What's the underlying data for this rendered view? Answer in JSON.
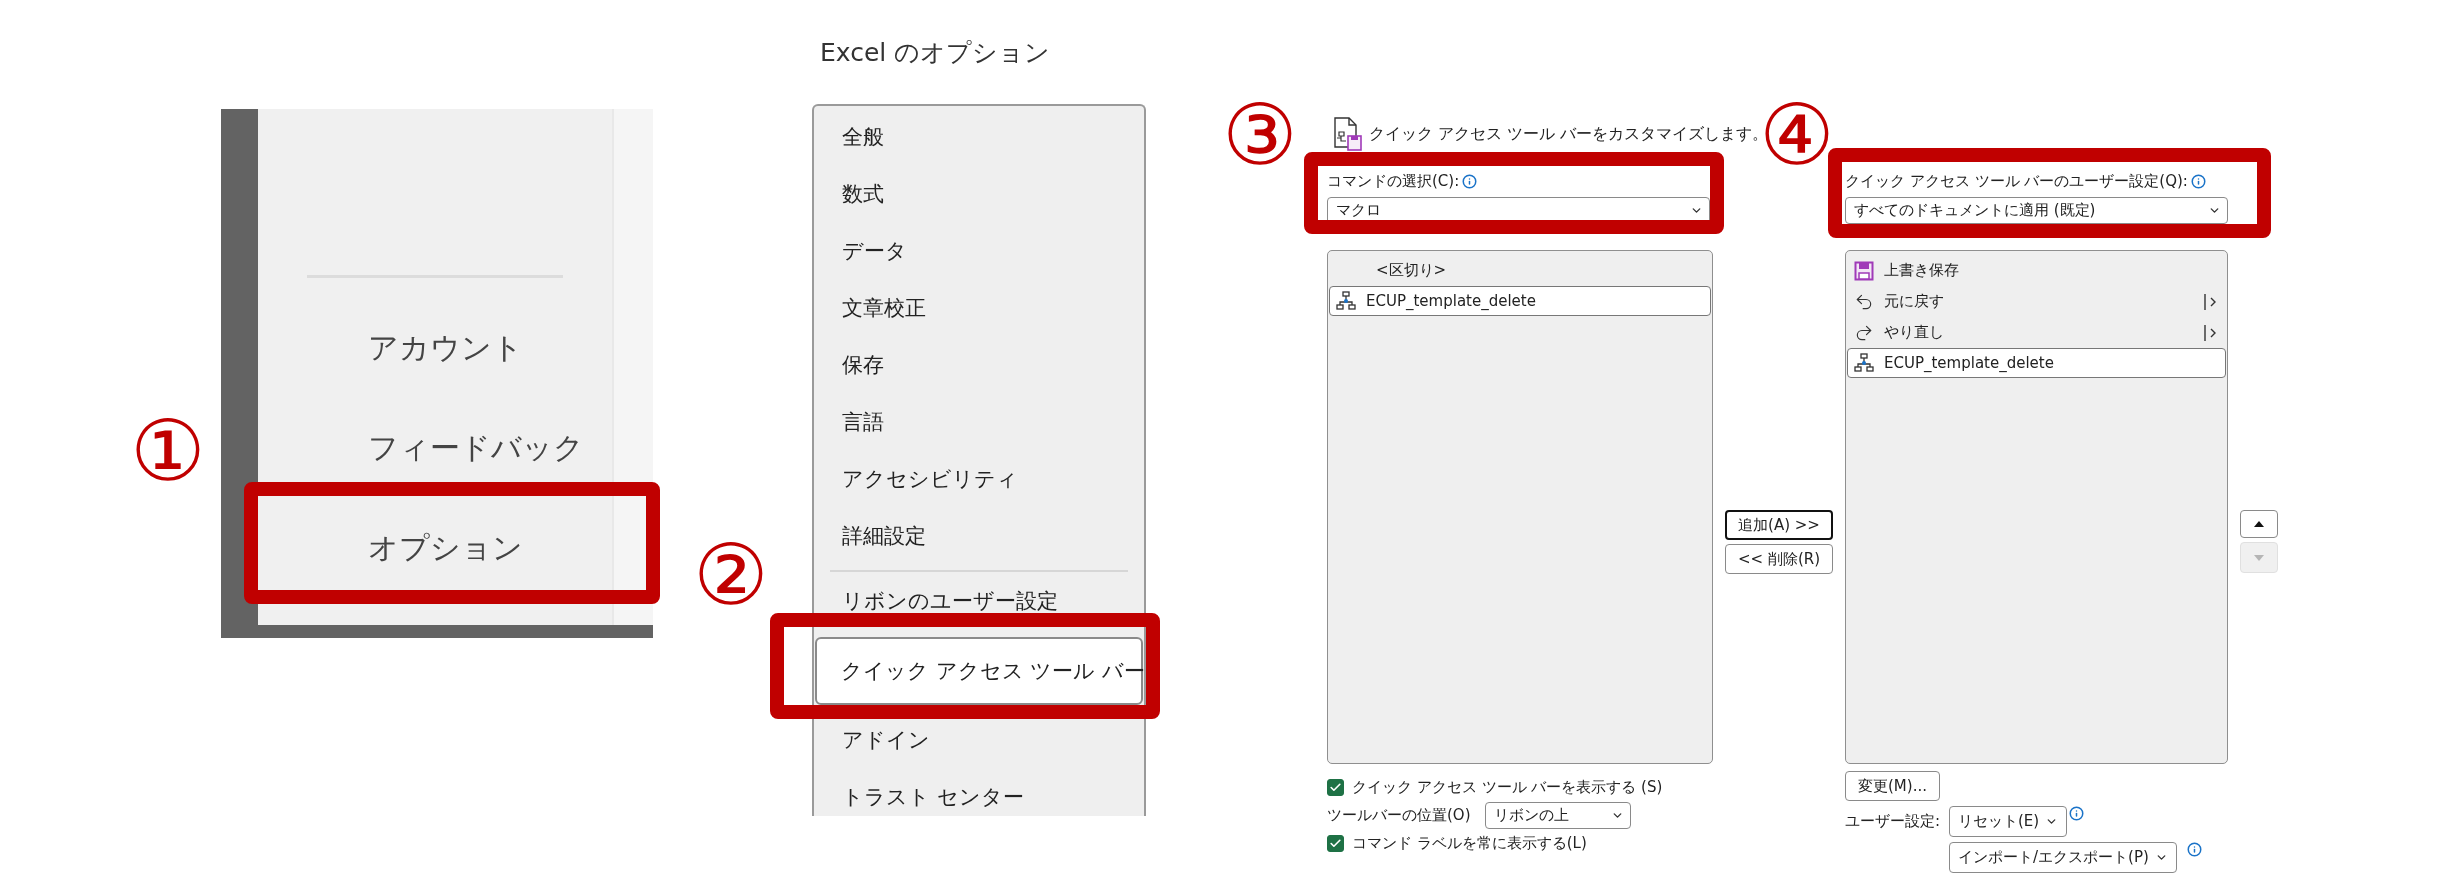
{
  "step_markers": [
    "①",
    "②",
    "③",
    "④"
  ],
  "backstage_menu": {
    "items": [
      {
        "label": "アカウント"
      },
      {
        "label": "フィードバック"
      },
      {
        "label": "オプション"
      }
    ]
  },
  "options_nav": {
    "title": "Excel のオプション",
    "items": [
      {
        "label": "全般",
        "selected": false
      },
      {
        "label": "数式",
        "selected": false
      },
      {
        "label": "データ",
        "selected": false
      },
      {
        "label": "文章校正",
        "selected": false
      },
      {
        "label": "保存",
        "selected": false
      },
      {
        "label": "言語",
        "selected": false
      },
      {
        "label": "アクセシビリティ",
        "selected": false
      },
      {
        "label": "詳細設定",
        "selected": false
      },
      {
        "label": "リボンのユーザー設定",
        "selected": false
      },
      {
        "label": "クイック アクセス ツール バー",
        "selected": true
      },
      {
        "label": "アドイン",
        "selected": false
      },
      {
        "label": "トラスト センター",
        "selected": false
      }
    ]
  },
  "qat": {
    "description": "クイック アクセス ツール バーをカスタマイズします。",
    "command_source": {
      "label": "コマンドの選択(C):",
      "value": "マクロ"
    },
    "available_commands": [
      {
        "label": "<区切り>",
        "kind": "separator",
        "selected": false
      },
      {
        "label": "ECUP_template_delete",
        "kind": "macro",
        "selected": true
      }
    ],
    "add_button": "追加(A) >>",
    "remove_button": "<< 削除(R)",
    "show_toolbar": {
      "label": "クイック アクセス ツール バーを表示する (S)",
      "checked": true
    },
    "toolbar_position": {
      "label": "ツールバーの位置(O)",
      "value": "リボンの上"
    },
    "show_labels": {
      "label": "コマンド ラベルを常に表示する(L)",
      "checked": true
    },
    "customize_for": {
      "label": "クイック アクセス ツール バーのユーザー設定(Q):",
      "value": "すべてのドキュメントに適用 (既定)"
    },
    "current_commands": [
      {
        "label": "上書き保存",
        "kind": "save",
        "selected": false,
        "submenu": false
      },
      {
        "label": "元に戻す",
        "kind": "undo",
        "selected": false,
        "submenu": true
      },
      {
        "label": "やり直し",
        "kind": "redo",
        "selected": false,
        "submenu": true
      },
      {
        "label": "ECUP_template_delete",
        "kind": "macro",
        "selected": true,
        "submenu": false
      }
    ],
    "move_up": {
      "disabled": false
    },
    "move_down": {
      "disabled": true
    },
    "modify_button": "変更(M)...",
    "user_settings_label": "ユーザー設定:",
    "reset_button": "リセット(E)",
    "import_export_button": "インポート/エクスポート(P)"
  }
}
